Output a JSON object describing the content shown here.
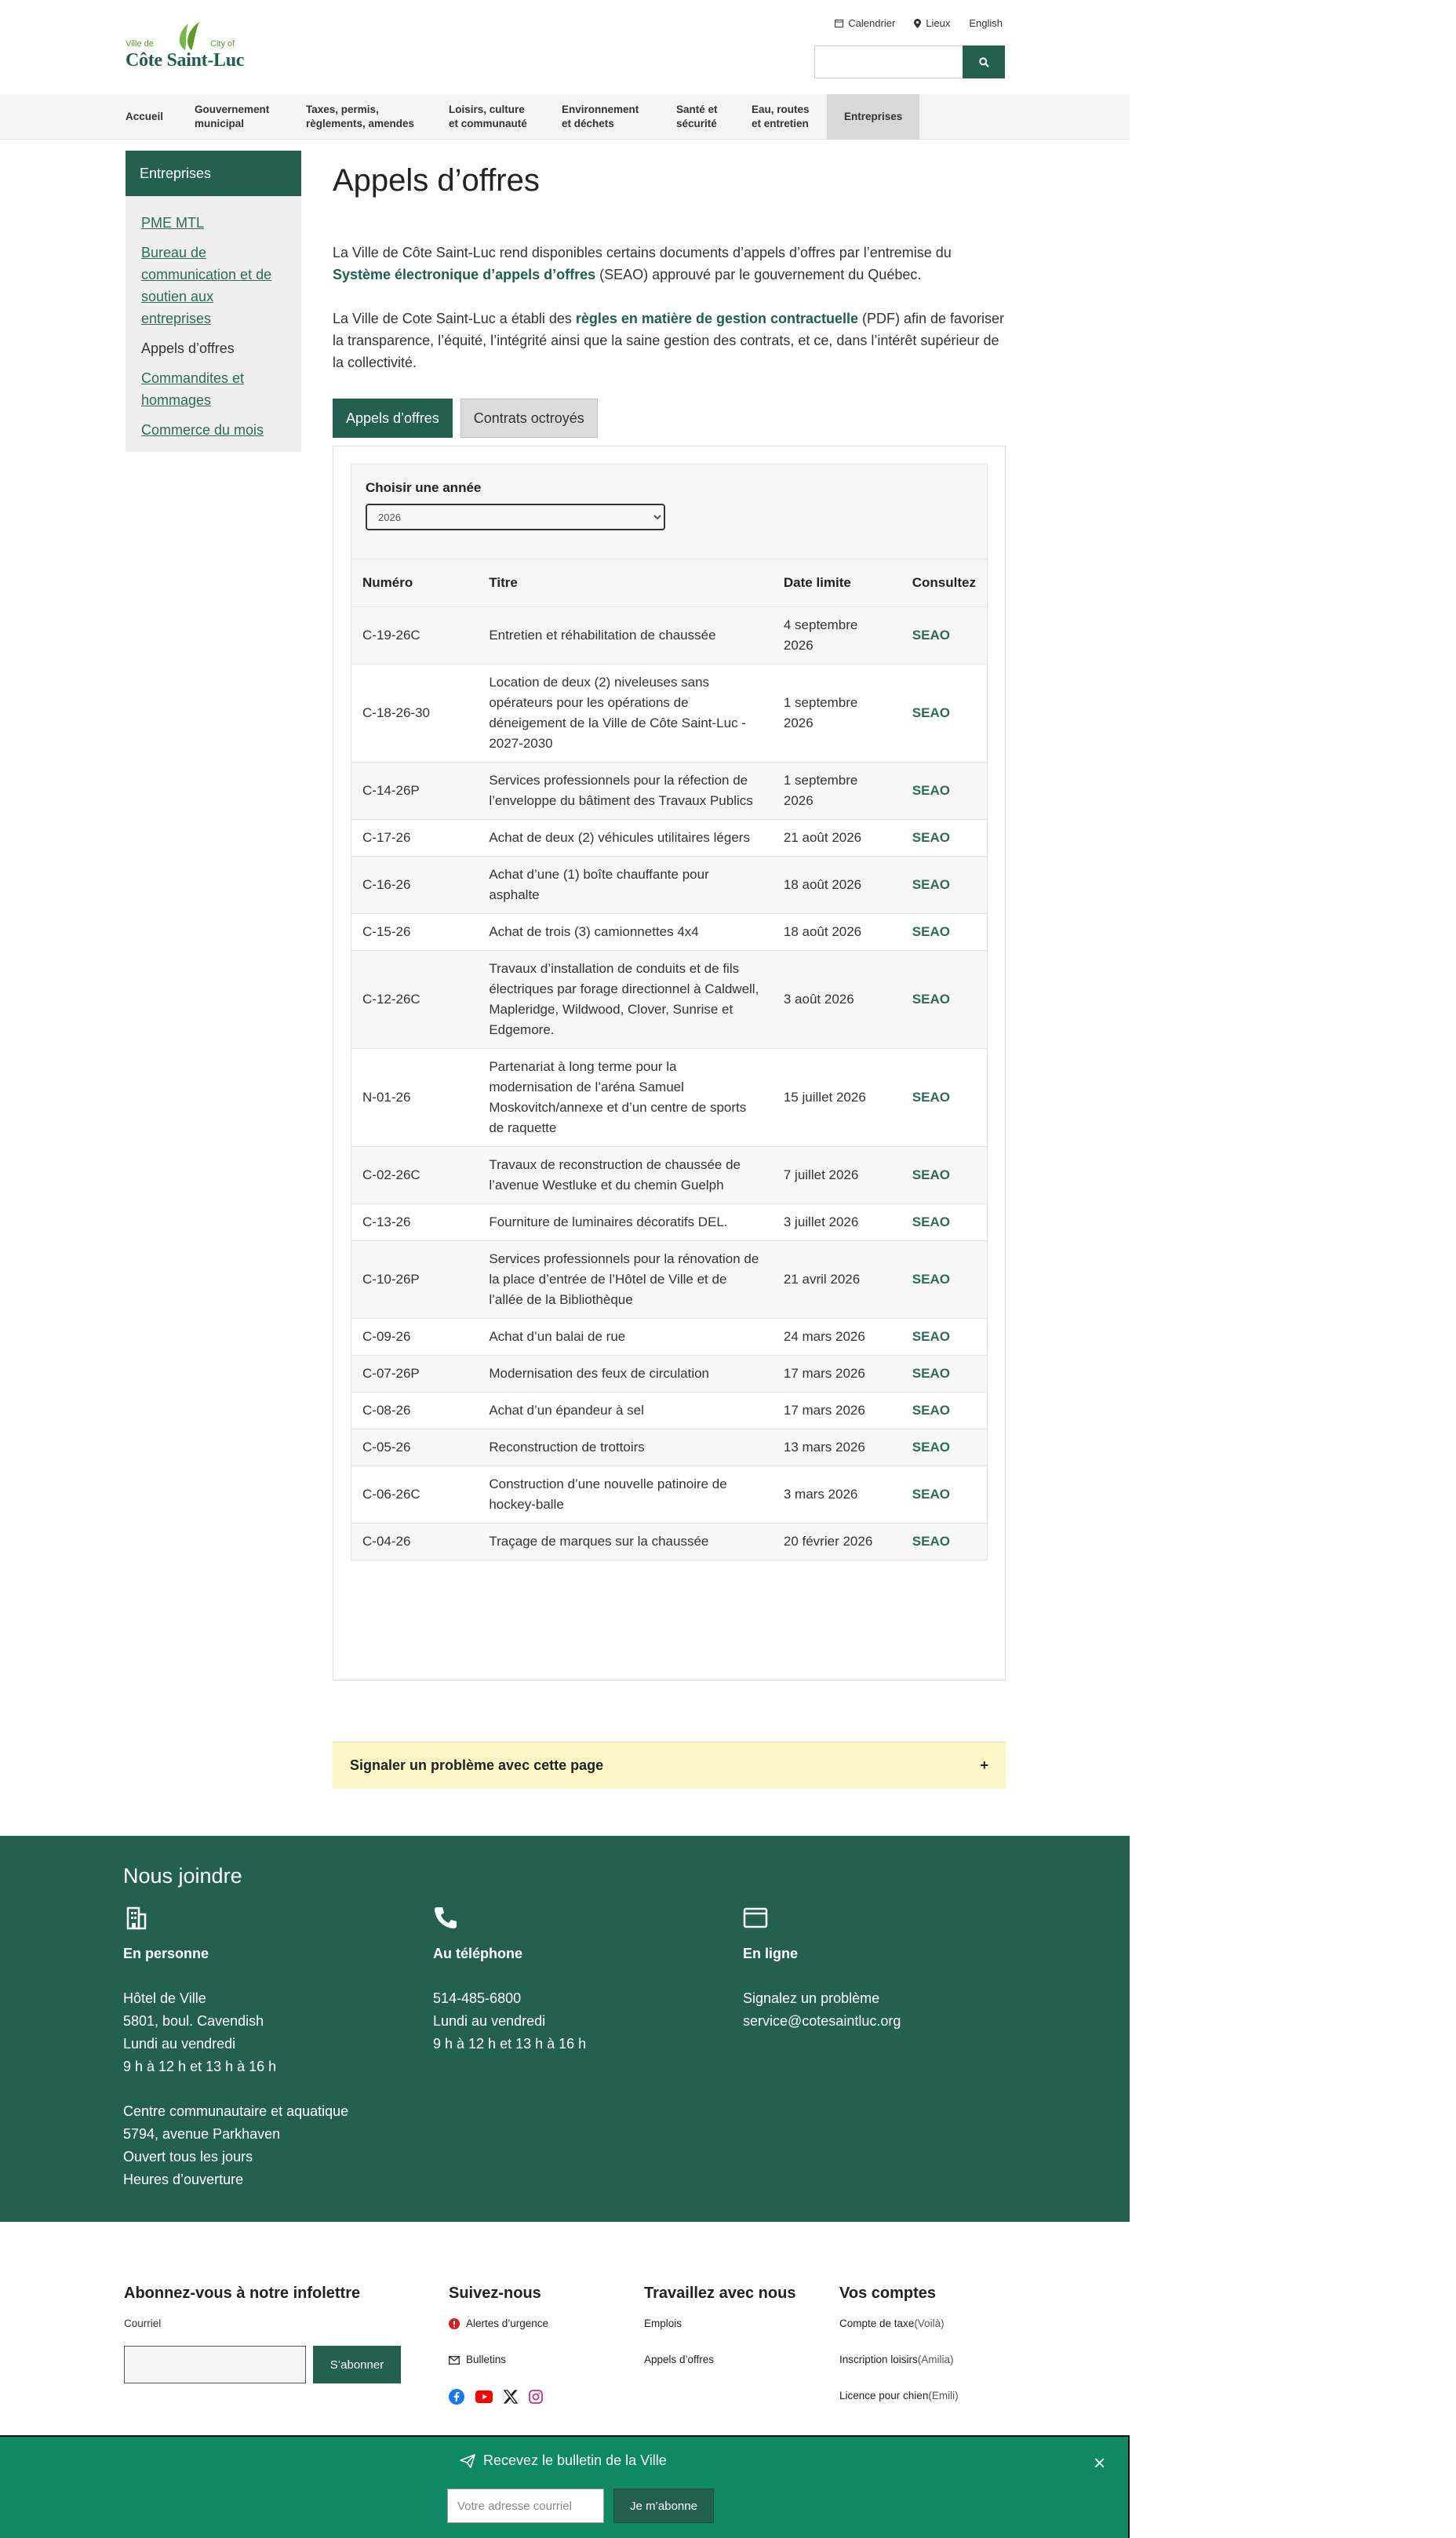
{
  "header": {
    "logo": {
      "ville": "Ville de",
      "city": "City of",
      "name": "Côte Saint-Luc"
    },
    "utility": [
      "Calendrier",
      "Lieux",
      "English"
    ],
    "search_placeholder": ""
  },
  "nav": {
    "items": [
      "Accueil",
      "Gouvernement\nmunicipal",
      "Taxes, permis,\nrèglements, amendes",
      "Loisirs, culture\net communauté",
      "Environnement\net déchets",
      "Santé et\nsécurité",
      "Eau, routes\net entretien",
      "Entreprises"
    ]
  },
  "sidebar": {
    "title": "Entreprises",
    "links": [
      "PME MTL",
      "Bureau de communication et de soutien aux entreprises",
      "Appels d’offres",
      "Commandites et hommages",
      "Commerce du mois"
    ]
  },
  "main": {
    "title": "Appels d’offres",
    "p1_a": "La Ville de Côte Saint-Luc rend disponibles certains documents d’appels d’offres par l’entremise du ",
    "p1_link": "Système électronique d’appels d’offres",
    "p1_b": " (SEAO) approuvé par le gouvernement du Québec.",
    "p2_a": "La Ville de Cote Saint-Luc a établi des ",
    "p2_link": "règles en matière de gestion contractuelle",
    "p2_b": " (PDF) afin de favoriser la transparence, l’équité, l’intégrité ainsi que la saine gestion des contrats, et ce, dans l’intérêt supérieur de la collectivité.",
    "tabs": [
      "Appels d’offres",
      "Contrats octroyés"
    ],
    "filter_label": "Choisir une année",
    "year": "2026",
    "table_headers": [
      "Numéro",
      "Titre",
      "Date limite",
      "Consultez"
    ],
    "rows": [
      [
        "C-19-26C",
        "Entretien et réhabilitation de chaussée",
        "4 septembre 2026",
        "SEAO"
      ],
      [
        "C-18-26-30",
        "Location de deux (2) niveleuses sans opérateurs pour les opérations de déneigement de la Ville de Côte Saint-Luc - 2027-2030",
        "1 septembre 2026",
        "SEAO"
      ],
      [
        "C-14-26P",
        "Services professionnels pour la réfection de l’enveloppe du bâtiment des Travaux Publics",
        "1 septembre 2026",
        "SEAO"
      ],
      [
        "C-17-26",
        "Achat de deux (2) véhicules utilitaires légers",
        "21 août 2026",
        "SEAO"
      ],
      [
        "C-16-26",
        "Achat d’une (1) boîte chauffante pour asphalte",
        "18 août 2026",
        "SEAO"
      ],
      [
        "C-15-26",
        "Achat de trois (3) camionnettes 4x4",
        "18 août 2026",
        "SEAO"
      ],
      [
        "C-12-26C",
        "Travaux d’installation de conduits et de fils électriques par forage directionnel à Caldwell, Mapleridge, Wildwood, Clover, Sunrise et Edgemore.",
        "3 août 2026",
        "SEAO"
      ],
      [
        "N-01-26",
        "Partenariat à long terme pour la modernisation de l’aréna Samuel Moskovitch/annexe et d’un centre de sports de raquette",
        "15 juillet 2026",
        "SEAO"
      ],
      [
        "C-02-26C",
        "Travaux de reconstruction de chaussée de l’avenue Westluke et du chemin Guelph",
        "7 juillet 2026",
        "SEAO"
      ],
      [
        "C-13-26",
        "Fourniture de luminaires décoratifs DEL.",
        "3 juillet 2026",
        "SEAO"
      ],
      [
        "C-10-26P",
        "Services professionnels pour la rénovation de la place d’entrée de l’Hôtel de Ville et de l’allée de la Bibliothèque",
        "21 avril 2026",
        "SEAO"
      ],
      [
        "C-09-26",
        "Achat d’un balai de rue",
        "24 mars 2026",
        "SEAO"
      ],
      [
        "C-07-26P",
        "Modernisation des feux de circulation",
        "17 mars 2026",
        "SEAO"
      ],
      [
        "C-08-26",
        "Achat d’un épandeur à sel",
        "17 mars 2026",
        "SEAO"
      ],
      [
        "C-05-26",
        "Reconstruction de trottoirs",
        "13 mars 2026",
        "SEAO"
      ],
      [
        "C-06-26C",
        "Construction d’une nouvelle patinoire de hockey-balle",
        "3 mars 2026",
        "SEAO"
      ],
      [
        "C-04-26",
        "Traçage de marques sur la chaussée",
        "20 février 2026",
        "SEAO"
      ]
    ],
    "report": "Signaler un problème avec cette page",
    "report_icon": "+"
  },
  "contact": {
    "title": "Nous joindre",
    "person": {
      "h": "En personne",
      "l1": "Hôtel de Ville",
      "l2": "5801, boul. Cavendish",
      "l3": "Lundi au vendredi",
      "l4": "9 h à 12 h et 13 h à 16 h",
      "l5": "Centre communautaire et aquatique",
      "l6": "5794, avenue Parkhaven",
      "l7": "Ouvert tous les jours",
      "l8": "Heures d’ouverture"
    },
    "phone": {
      "h": "Au téléphone",
      "l1": "514-485-6800",
      "l2": "Lundi au vendredi",
      "l3": "9 h à 12 h et 13 h à 16 h"
    },
    "online": {
      "h": "En ligne",
      "l1": "Signalez un problème",
      "l2": "service@cotesaintluc.org"
    }
  },
  "footer": {
    "newsletter": {
      "h": "Abonnez-vous à notre infolettre",
      "label": "Courriel",
      "button": "S’abonner"
    },
    "follow": {
      "h": "Suivez-nous",
      "i1": "Alertes d’urgence",
      "i2": "Bulletins"
    },
    "work": {
      "h": "Travaillez avec nous",
      "i1": "Emplois",
      "i2": "Appels d’offres"
    },
    "accounts": {
      "h": "Vos comptes",
      "i1": "Compte de taxe",
      "s1": " (Voilà)",
      "i2": "Inscription loisirs",
      "s2": " (Amilia)",
      "i3": "Licence pour chien",
      "s3": " (Emili)"
    }
  },
  "banner": {
    "title": "Recevez le bulletin de la Ville",
    "placeholder": "Votre adresse courriel",
    "button": "Je m’abonne",
    "close": "×"
  },
  "colors": {
    "brand_green": "#24604f",
    "banner_green": "#0f8866",
    "report_yellow": "#fbf6c5"
  }
}
